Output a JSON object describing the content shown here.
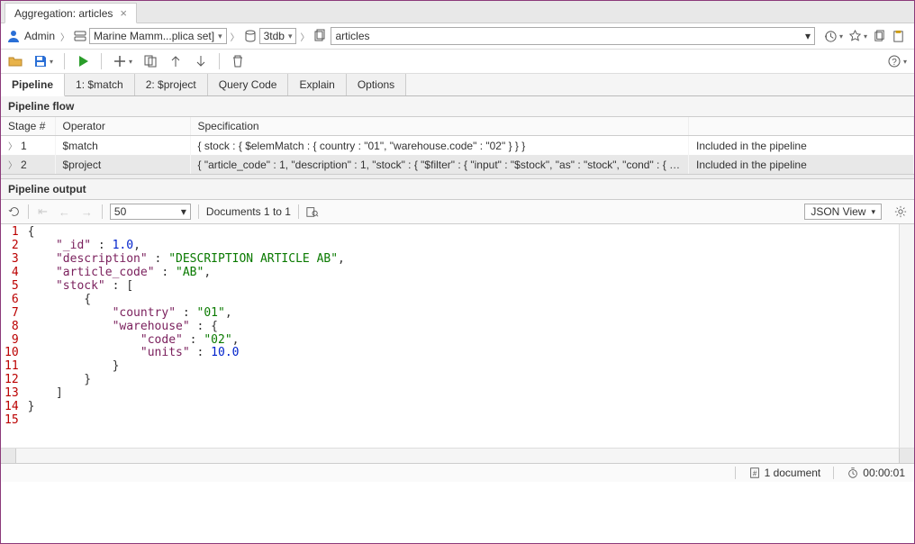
{
  "tab": {
    "title": "Aggregation: articles"
  },
  "breadcrumb": {
    "user": "Admin",
    "connection": "Marine Mamm...plica set]",
    "database": "3tdb",
    "collection": "articles"
  },
  "subtabs": [
    "Pipeline",
    "1: $match",
    "2: $project",
    "Query Code",
    "Explain",
    "Options"
  ],
  "pipeline_flow": {
    "header": "Pipeline flow",
    "columns": [
      "Stage #",
      "Operator",
      "Specification",
      ""
    ],
    "rows": [
      {
        "stage": "1",
        "operator": "$match",
        "spec": "{ stock : { $elemMatch : { country : \"01\", \"warehouse.code\" : \"02\" } } }",
        "status": "Included in the pipeline"
      },
      {
        "stage": "2",
        "operator": "$project",
        "spec": "{ \"article_code\" : 1, \"description\" : 1, \"stock\" : { \"$filter\" : { \"input\" : \"$stock\", \"as\" : \"stock\", \"cond\" : { \"$a...",
        "status": "Included in the pipeline"
      }
    ]
  },
  "output": {
    "header": "Pipeline output",
    "page_size": "50",
    "range_label": "Documents 1 to 1",
    "view": "JSON View"
  },
  "code_lines": [
    {
      "n": 1,
      "tokens": [
        {
          "t": "punc",
          "v": "{"
        }
      ]
    },
    {
      "n": 2,
      "tokens": [
        {
          "t": "ind",
          "v": "    "
        },
        {
          "t": "key",
          "v": "\"_id\""
        },
        {
          "t": "punc",
          "v": " : "
        },
        {
          "t": "num",
          "v": "1.0"
        },
        {
          "t": "punc",
          "v": ","
        }
      ]
    },
    {
      "n": 3,
      "tokens": [
        {
          "t": "ind",
          "v": "    "
        },
        {
          "t": "key",
          "v": "\"description\""
        },
        {
          "t": "punc",
          "v": " : "
        },
        {
          "t": "str",
          "v": "\"DESCRIPTION ARTICLE AB\""
        },
        {
          "t": "punc",
          "v": ","
        }
      ]
    },
    {
      "n": 4,
      "tokens": [
        {
          "t": "ind",
          "v": "    "
        },
        {
          "t": "key",
          "v": "\"article_code\""
        },
        {
          "t": "punc",
          "v": " : "
        },
        {
          "t": "str",
          "v": "\"AB\""
        },
        {
          "t": "punc",
          "v": ","
        }
      ]
    },
    {
      "n": 5,
      "tokens": [
        {
          "t": "ind",
          "v": "    "
        },
        {
          "t": "key",
          "v": "\"stock\""
        },
        {
          "t": "punc",
          "v": " : ["
        }
      ]
    },
    {
      "n": 6,
      "tokens": [
        {
          "t": "ind",
          "v": "        "
        },
        {
          "t": "punc",
          "v": "{"
        }
      ]
    },
    {
      "n": 7,
      "tokens": [
        {
          "t": "ind",
          "v": "            "
        },
        {
          "t": "key",
          "v": "\"country\""
        },
        {
          "t": "punc",
          "v": " : "
        },
        {
          "t": "str",
          "v": "\"01\""
        },
        {
          "t": "punc",
          "v": ","
        }
      ]
    },
    {
      "n": 8,
      "tokens": [
        {
          "t": "ind",
          "v": "            "
        },
        {
          "t": "key",
          "v": "\"warehouse\""
        },
        {
          "t": "punc",
          "v": " : {"
        }
      ]
    },
    {
      "n": 9,
      "tokens": [
        {
          "t": "ind",
          "v": "                "
        },
        {
          "t": "key",
          "v": "\"code\""
        },
        {
          "t": "punc",
          "v": " : "
        },
        {
          "t": "str",
          "v": "\"02\""
        },
        {
          "t": "punc",
          "v": ","
        }
      ]
    },
    {
      "n": 10,
      "tokens": [
        {
          "t": "ind",
          "v": "                "
        },
        {
          "t": "key",
          "v": "\"units\""
        },
        {
          "t": "punc",
          "v": " : "
        },
        {
          "t": "num",
          "v": "10.0"
        }
      ]
    },
    {
      "n": 11,
      "tokens": [
        {
          "t": "ind",
          "v": "            "
        },
        {
          "t": "punc",
          "v": "}"
        }
      ]
    },
    {
      "n": 12,
      "tokens": [
        {
          "t": "ind",
          "v": "        "
        },
        {
          "t": "punc",
          "v": "}"
        }
      ]
    },
    {
      "n": 13,
      "tokens": [
        {
          "t": "ind",
          "v": "    "
        },
        {
          "t": "punc",
          "v": "]"
        }
      ]
    },
    {
      "n": 14,
      "tokens": [
        {
          "t": "punc",
          "v": "}"
        }
      ]
    },
    {
      "n": 15,
      "tokens": []
    }
  ],
  "status": {
    "doc_count": "1 document",
    "elapsed": "00:00:01"
  }
}
